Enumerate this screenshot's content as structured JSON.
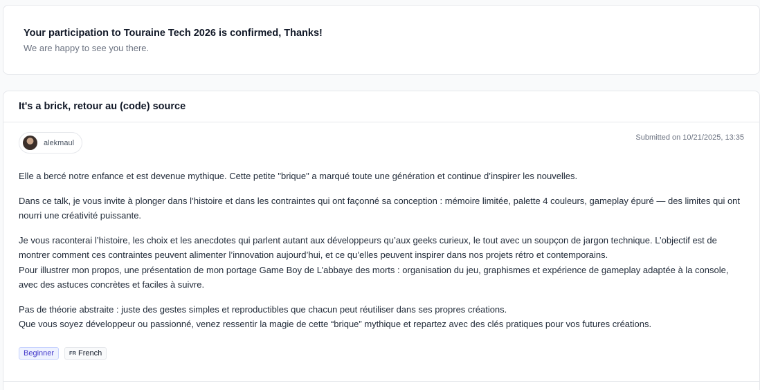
{
  "confirmation": {
    "title": "Your participation to Touraine Tech 2026 is confirmed, Thanks!",
    "subtitle": "We are happy to see you there."
  },
  "talk": {
    "title": "It's a brick, retour au (code) source",
    "speaker": {
      "name": "alekmaul",
      "avatar_icon": "user-avatar"
    },
    "submitted": "Submitted on 10/21/2025, 13:35",
    "abstract": [
      "Elle a bercé notre enfance et est devenue mythique. Cette petite \"brique\" a marqué toute une génération et continue d’inspirer les nouvelles.",
      "Dans ce talk, je vous invite à plonger dans l’histoire et dans les contraintes qui ont façonné sa conception : mémoire limitée, palette 4 couleurs, gameplay épuré — des limites qui ont nourri une créativité puissante.",
      "Je vous raconterai l’histoire, les choix et les anecdotes qui parlent autant aux développeurs qu’aux geeks curieux, le tout avec un soupçon de jargon technique. L’objectif est de montrer comment ces contraintes peuvent alimenter l’innovation aujourd’hui, et ce qu’elles peuvent inspirer dans nos projets rétro et contemporains.",
      "Pour illustrer mon propos, une présentation de mon portage Game Boy de L’abbaye des morts : organisation du jeu, graphismes et expérience de gameplay adaptée à la console, avec des astuces concrètes et faciles à suivre.",
      "Pas de théorie abstraite : juste des gestes simples et reproductibles que chacun peut réutiliser dans ses propres créations.",
      "Que vous soyez développeur ou passionné, venez ressentir la magie de cette “brique” mythique et repartez avec des clés pratiques pour vos futures créations."
    ],
    "tags": {
      "level": "Beginner",
      "language_code": "FR",
      "language": "French"
    }
  },
  "colors": {
    "level_tag_bg": "#eef2ff",
    "level_tag_text": "#4338ca",
    "border": "#e5e7eb"
  }
}
